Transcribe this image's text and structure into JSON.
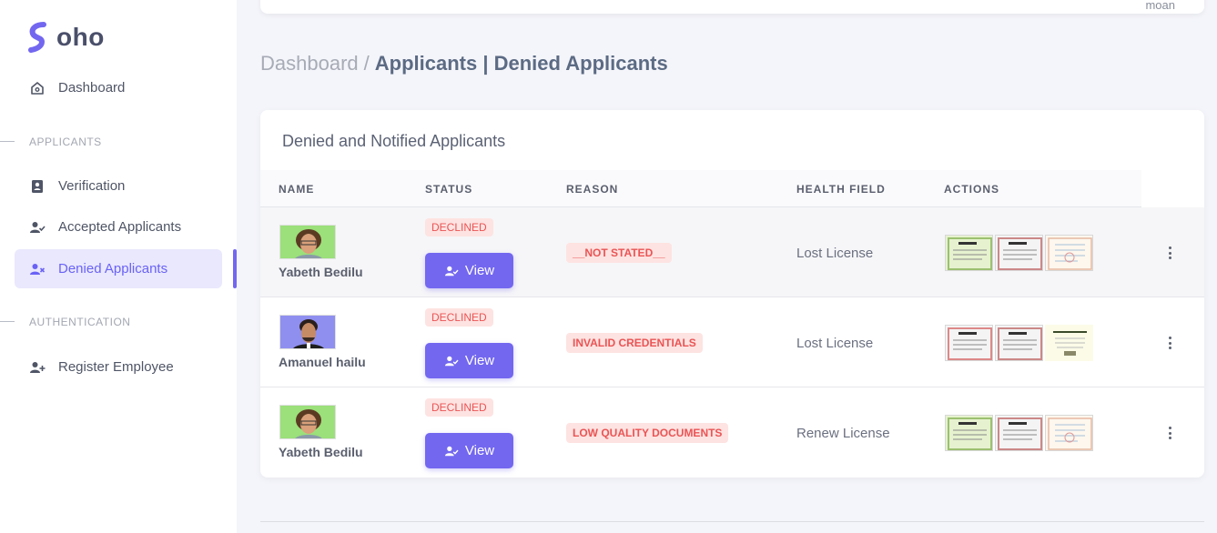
{
  "brand": {
    "name": "oho"
  },
  "topbar": {
    "user": "moan"
  },
  "sidebar": {
    "dashboard": "Dashboard",
    "sections": [
      {
        "label": "APPLICANTS"
      },
      {
        "label": "AUTHENTICATION"
      }
    ],
    "items": [
      {
        "label": "Verification",
        "icon": "id-card-icon"
      },
      {
        "label": "Accepted Applicants",
        "icon": "user-check-icon"
      },
      {
        "label": "Denied Applicants",
        "icon": "user-x-icon"
      },
      {
        "label": "Register Employee",
        "icon": "user-plus-icon"
      }
    ],
    "active": "Denied Applicants"
  },
  "breadcrumb": {
    "root": "Dashboard",
    "separator": "/",
    "current": "Applicants | Denied Applicants"
  },
  "card": {
    "title": "Denied and Notified Applicants",
    "columns": [
      "NAME",
      "STATUS",
      "REASON",
      "HEALTH FIELD",
      "ACTIONS"
    ],
    "rows": [
      {
        "name": "Yabeth Bedilu",
        "status": "DECLINED",
        "button": "View",
        "reason": "__NOT STATED__",
        "health_field": "Lost License"
      },
      {
        "name": "Amanuel hailu",
        "status": "DECLINED",
        "button": "View",
        "reason": "INVALID CREDENTIALS",
        "health_field": "Lost License"
      },
      {
        "name": "Yabeth Bedilu",
        "status": "DECLINED",
        "button": "View",
        "reason": "LOW QUALITY DOCUMENTS",
        "health_field": "Renew License"
      }
    ]
  },
  "colors": {
    "accent": "#7367f0",
    "danger": "#ea5455",
    "danger_bg": "#fde3e1"
  }
}
